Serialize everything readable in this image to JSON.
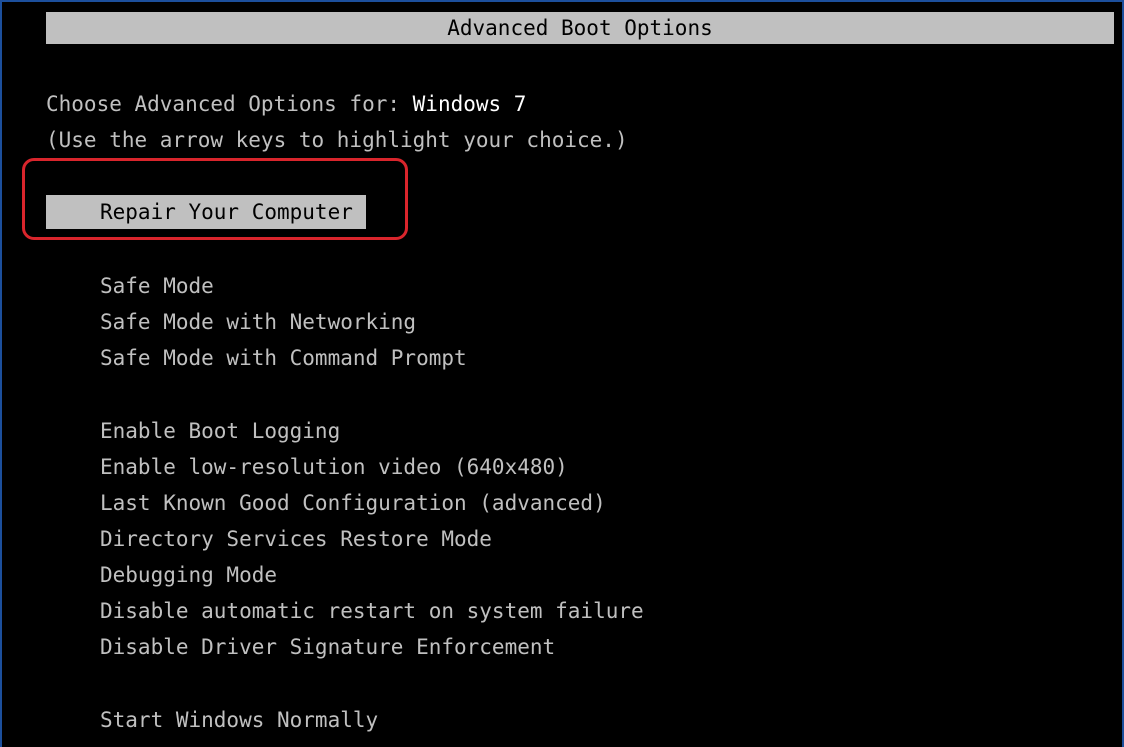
{
  "title": "Advanced Boot Options",
  "prompt": {
    "label": "Choose Advanced Options for: ",
    "os_name": "Windows 7"
  },
  "hint": "(Use the arrow keys to highlight your choice.)",
  "selected_option": "Repair Your Computer",
  "options": [
    "Safe Mode",
    "Safe Mode with Networking",
    "Safe Mode with Command Prompt",
    "Enable Boot Logging",
    "Enable low-resolution video (640x480)",
    "Last Known Good Configuration (advanced)",
    "Directory Services Restore Mode",
    "Debugging Mode",
    "Disable automatic restart on system failure",
    "Disable Driver Signature Enforcement",
    "Start Windows Normally"
  ],
  "colors": {
    "background": "#000000",
    "text": "#c0c0c0",
    "highlight_bar": "#c0c0c0",
    "annotation_ring": "#d9252c"
  }
}
